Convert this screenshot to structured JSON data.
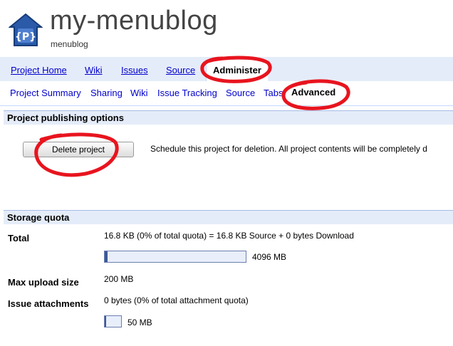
{
  "header": {
    "title": "my-menublog",
    "subtitle": "menublog",
    "logo_letter": "{P}"
  },
  "main_tabs": [
    {
      "label": "Project Home",
      "active": false
    },
    {
      "label": "Wiki",
      "active": false
    },
    {
      "label": "Issues",
      "active": false
    },
    {
      "label": "Source",
      "active": false
    },
    {
      "label": "Administer",
      "active": true
    }
  ],
  "sub_tabs": [
    {
      "label": "Project Summary",
      "active": false
    },
    {
      "label": "Sharing",
      "active": false
    },
    {
      "label": "Wiki",
      "active": false
    },
    {
      "label": "Issue Tracking",
      "active": false
    },
    {
      "label": "Source",
      "active": false
    },
    {
      "label": "Tabs",
      "active": false
    },
    {
      "label": "Advanced",
      "active": true
    }
  ],
  "publishing": {
    "heading": "Project publishing options",
    "delete_button": "Delete project",
    "delete_description": "Schedule this project for deletion. All project contents will be completely d"
  },
  "storage": {
    "heading": "Storage quota",
    "total_label": "Total",
    "total_value": "16.8 KB (0% of total quota)  = 16.8 KB Source + 0 bytes Download",
    "total_bar_caption": "4096 MB",
    "total_bar_fraction": 0.02,
    "max_upload_label": "Max upload size",
    "max_upload_value": "200 MB",
    "attachments_label": "Issue attachments",
    "attachments_value": "0 bytes (0% of total attachment quota)",
    "attachments_bar_caption": "50 MB",
    "attachments_bar_fraction": 0.1
  },
  "colors": {
    "link": "#0000cc",
    "tab_bar": "#e5ecf9",
    "annotation": "#e8141e"
  }
}
